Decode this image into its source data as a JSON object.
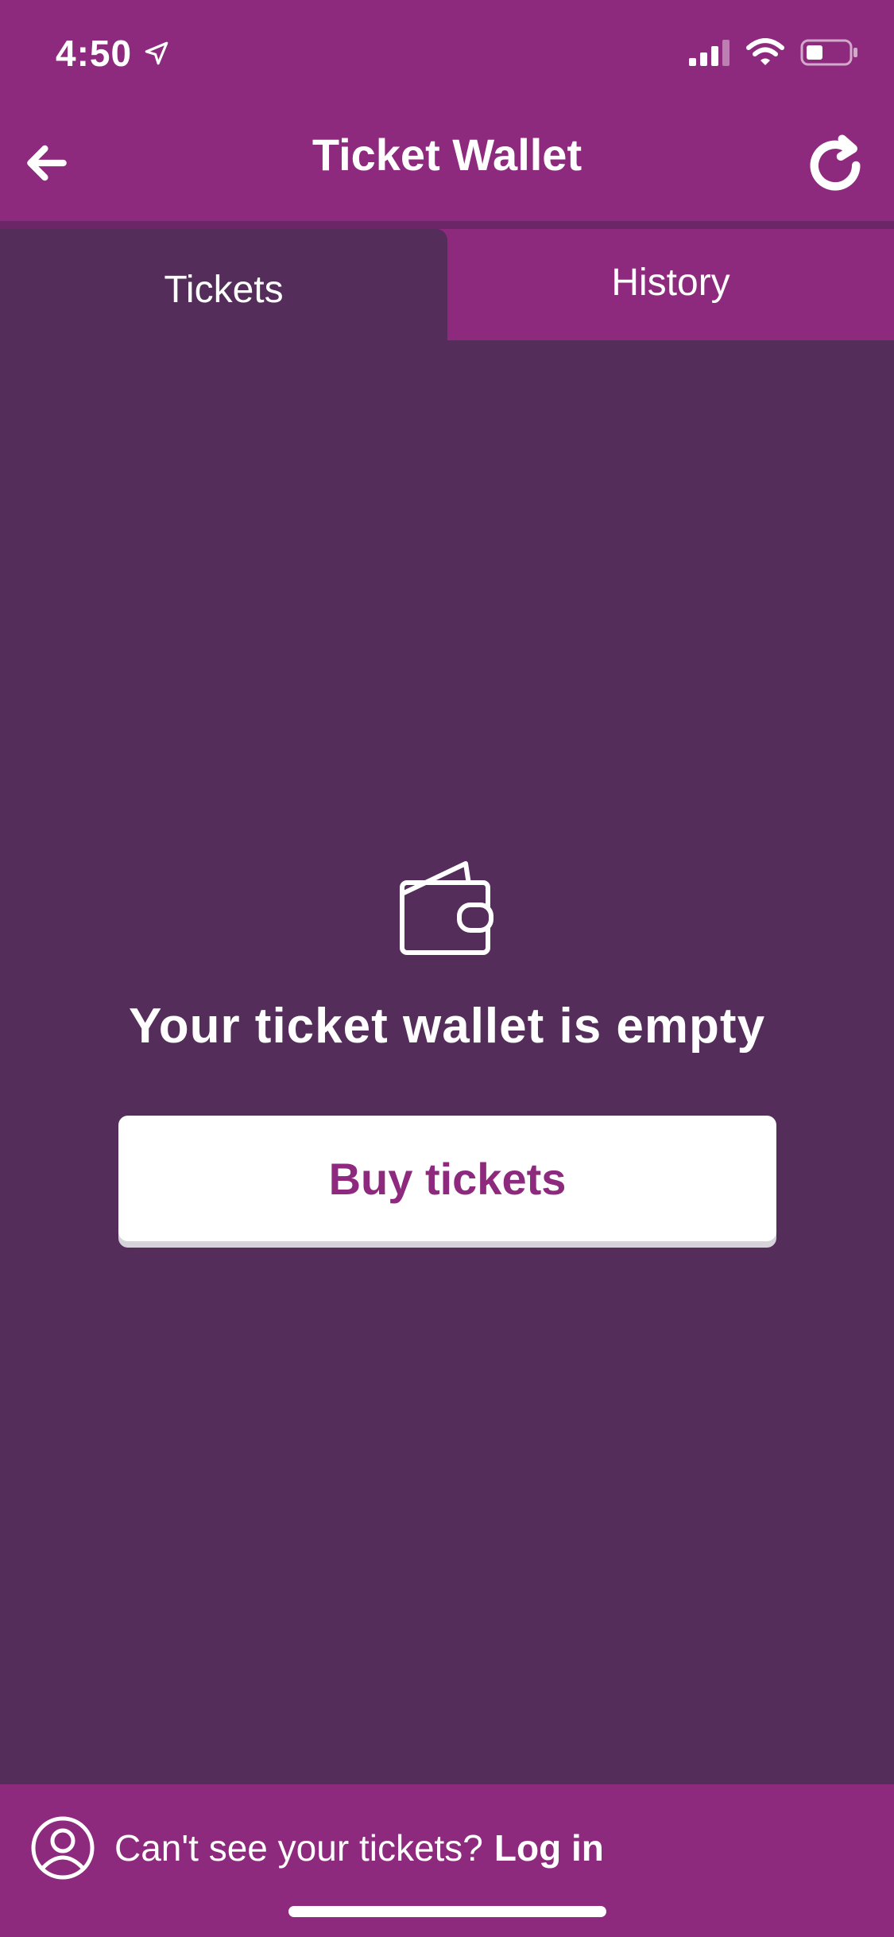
{
  "status_bar": {
    "time": "4:50",
    "icons": [
      "location-arrow-icon",
      "cellular-signal-icon",
      "wifi-icon",
      "battery-icon"
    ]
  },
  "header": {
    "title": "Ticket Wallet",
    "back_icon": "arrow-left-icon",
    "refresh_icon": "refresh-icon"
  },
  "tabs": [
    {
      "label": "Tickets",
      "active": true
    },
    {
      "label": "History",
      "active": false
    }
  ],
  "empty_state": {
    "icon": "wallet-icon",
    "message": "Your ticket wallet is empty",
    "button_label": "Buy tickets"
  },
  "footer": {
    "icon": "user-account-icon",
    "prompt": "Can't see your tickets?",
    "login_label": "Log in"
  },
  "colors": {
    "header_bg": "#8e2a7d",
    "content_bg": "#552d5b",
    "button_text": "#8e2a7d",
    "text": "#ffffff"
  }
}
